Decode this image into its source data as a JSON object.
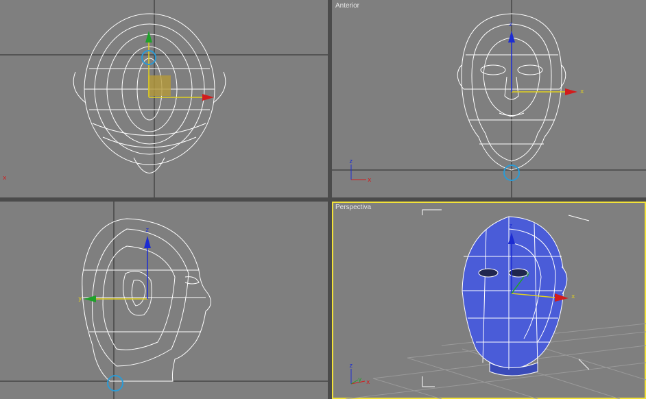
{
  "viewports": {
    "top": {
      "label": ""
    },
    "front": {
      "label": "Anterior"
    },
    "left": {
      "label": ""
    },
    "perspective": {
      "label": "Perspectiva"
    }
  },
  "axes": {
    "x": "x",
    "y": "y",
    "z": "z"
  },
  "colors": {
    "background": "#7f7f7f",
    "frame": "#4b4b4b",
    "active_border": "#f2e23a",
    "wire": "#ffffff",
    "gizmo_x": "#d21c1c",
    "gizmo_y": "#1fa12a",
    "gizmo_z": "#1c2cd2",
    "pivot": "#2a9bd6",
    "shaded_head": "#4a5cd8"
  }
}
